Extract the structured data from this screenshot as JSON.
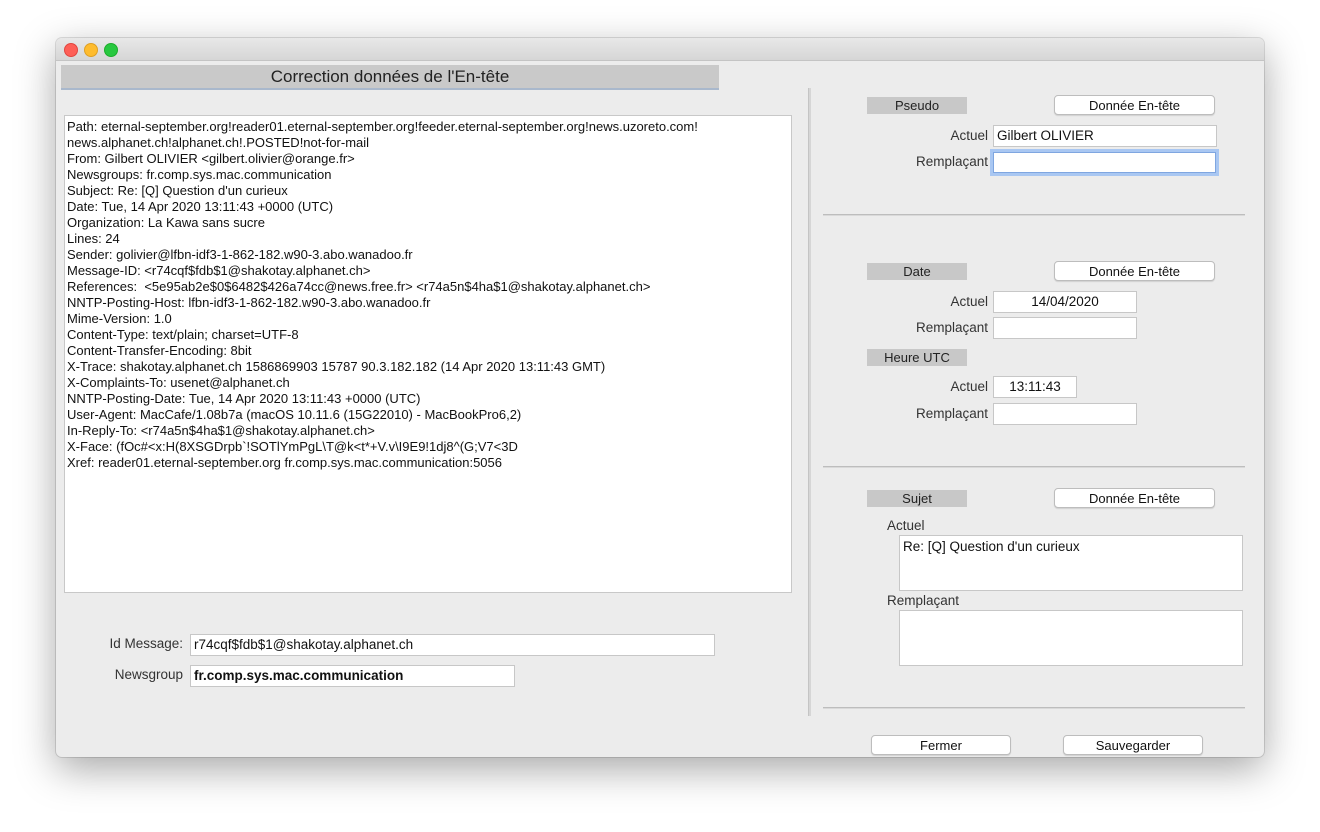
{
  "window": {
    "title": "Correction données de l'En-tête"
  },
  "headers_text": [
    "Path: eternal-september.org!reader01.eternal-september.org!feeder.eternal-september.org!news.uzoreto.com!",
    "news.alphanet.ch!alphanet.ch!.POSTED!not-for-mail",
    "From: Gilbert OLIVIER <gilbert.olivier@orange.fr>",
    "Newsgroups: fr.comp.sys.mac.communication",
    "Subject: Re: [Q] Question d'un curieux",
    "Date: Tue, 14 Apr 2020 13:11:43 +0000 (UTC)",
    "Organization: La Kawa sans sucre",
    "Lines: 24",
    "Sender: golivier@lfbn-idf3-1-862-182.w90-3.abo.wanadoo.fr",
    "Message-ID: <r74cqf$fdb$1@shakotay.alphanet.ch>",
    "References:  <5e95ab2e$0$6482$426a74cc@news.free.fr> <r74a5n$4ha$1@shakotay.alphanet.ch>",
    "NNTP-Posting-Host: lfbn-idf3-1-862-182.w90-3.abo.wanadoo.fr",
    "Mime-Version: 1.0",
    "Content-Type: text/plain; charset=UTF-8",
    "Content-Transfer-Encoding: 8bit",
    "X-Trace: shakotay.alphanet.ch 1586869903 15787 90.3.182.182 (14 Apr 2020 13:11:43 GMT)",
    "X-Complaints-To: usenet@alphanet.ch",
    "NNTP-Posting-Date: Tue, 14 Apr 2020 13:11:43 +0000 (UTC)",
    "User-Agent: MacCafe/1.08b7a (macOS 10.11.6 (15G22010) - MacBookPro6,2)",
    "In-Reply-To: <r74a5n$4ha$1@shakotay.alphanet.ch>",
    "X-Face: (fOc#<x:H(8XSGDrpb`!SOTlYmPgL\\T@k<t*+V.v\\I9E9!1dj8^(G;V7<3D",
    "Xref: reader01.eternal-september.org fr.comp.sys.mac.communication:5056"
  ],
  "message": {
    "id_label": "Id Message:",
    "id_value": "r74cqf$fdb$1@shakotay.alphanet.ch",
    "newsgroup_label": "Newsgroup",
    "newsgroup_value": "fr.comp.sys.mac.communication"
  },
  "pseudo": {
    "tag": "Pseudo",
    "header_button": "Donnée En-tête",
    "actuel_label": "Actuel",
    "actuel_value": "Gilbert OLIVIER",
    "remplacant_label": "Remplaçant",
    "remplacant_value": ""
  },
  "date": {
    "tag": "Date",
    "header_button": "Donnée En-tête",
    "actuel_label": "Actuel",
    "actuel_value": "14/04/2020",
    "remplacant_label": "Remplaçant",
    "remplacant_value": ""
  },
  "heure": {
    "tag": "Heure UTC",
    "actuel_label": "Actuel",
    "actuel_value": "13:11:43",
    "remplacant_label": "Remplaçant",
    "remplacant_value": ""
  },
  "sujet": {
    "tag": "Sujet",
    "header_button": "Donnée En-tête",
    "actuel_label": "Actuel",
    "actuel_value": "Re: [Q] Question d'un curieux",
    "remplacant_label": "Remplaçant",
    "remplacant_value": ""
  },
  "footer": {
    "close_label": "Fermer",
    "save_label": "Sauvegarder"
  }
}
